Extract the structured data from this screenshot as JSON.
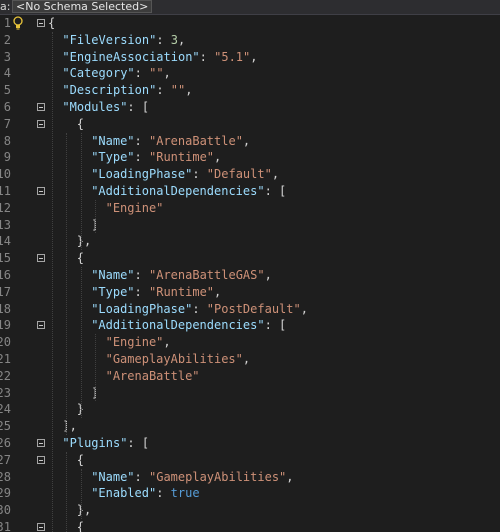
{
  "schema_bar": {
    "prefix": "a:",
    "selected": "<No Schema Selected>"
  },
  "lines": [
    {
      "num": "1",
      "fold": true,
      "tokens": [
        [
          "p",
          "{"
        ]
      ]
    },
    {
      "num": "2",
      "tokens": [
        [
          "k",
          "\"FileVersion\""
        ],
        [
          "p",
          ": "
        ],
        [
          "n",
          "3"
        ],
        [
          "p",
          ","
        ]
      ]
    },
    {
      "num": "3",
      "tokens": [
        [
          "k",
          "\"EngineAssociation\""
        ],
        [
          "p",
          ": "
        ],
        [
          "s",
          "\"5.1\""
        ],
        [
          "p",
          ","
        ]
      ]
    },
    {
      "num": "4",
      "tokens": [
        [
          "k",
          "\"Category\""
        ],
        [
          "p",
          ": "
        ],
        [
          "s",
          "\"\""
        ],
        [
          "p",
          ","
        ]
      ]
    },
    {
      "num": "5",
      "tokens": [
        [
          "k",
          "\"Description\""
        ],
        [
          "p",
          ": "
        ],
        [
          "s",
          "\"\""
        ],
        [
          "p",
          ","
        ]
      ]
    },
    {
      "num": "6",
      "fold": true,
      "tokens": [
        [
          "k",
          "\"Modules\""
        ],
        [
          "p",
          ": ["
        ]
      ]
    },
    {
      "num": "7",
      "fold": true,
      "tokens": [
        [
          "p",
          "{"
        ]
      ]
    },
    {
      "num": "8",
      "tokens": [
        [
          "k",
          "\"Name\""
        ],
        [
          "p",
          ": "
        ],
        [
          "s",
          "\"ArenaBattle\""
        ],
        [
          "p",
          ","
        ]
      ]
    },
    {
      "num": "9",
      "tokens": [
        [
          "k",
          "\"Type\""
        ],
        [
          "p",
          ": "
        ],
        [
          "s",
          "\"Runtime\""
        ],
        [
          "p",
          ","
        ]
      ]
    },
    {
      "num": "10",
      "tokens": [
        [
          "k",
          "\"LoadingPhase\""
        ],
        [
          "p",
          ": "
        ],
        [
          "s",
          "\"Default\""
        ],
        [
          "p",
          ","
        ]
      ]
    },
    {
      "num": "11",
      "fold": true,
      "tokens": [
        [
          "k",
          "\"AdditionalDependencies\""
        ],
        [
          "p",
          ": ["
        ]
      ]
    },
    {
      "num": "12",
      "tokens": [
        [
          "s",
          "\"Engine\""
        ]
      ]
    },
    {
      "num": "13",
      "tokens": [
        [
          "p",
          "]"
        ]
      ]
    },
    {
      "num": "14",
      "tokens": [
        [
          "p",
          "},"
        ]
      ]
    },
    {
      "num": "15",
      "fold": true,
      "tokens": [
        [
          "p",
          "{"
        ]
      ]
    },
    {
      "num": "16",
      "tokens": [
        [
          "k",
          "\"Name\""
        ],
        [
          "p",
          ": "
        ],
        [
          "s",
          "\"ArenaBattleGAS\""
        ],
        [
          "p",
          ","
        ]
      ]
    },
    {
      "num": "17",
      "tokens": [
        [
          "k",
          "\"Type\""
        ],
        [
          "p",
          ": "
        ],
        [
          "s",
          "\"Runtime\""
        ],
        [
          "p",
          ","
        ]
      ]
    },
    {
      "num": "18",
      "tokens": [
        [
          "k",
          "\"LoadingPhase\""
        ],
        [
          "p",
          ": "
        ],
        [
          "s",
          "\"PostDefault\""
        ],
        [
          "p",
          ","
        ]
      ]
    },
    {
      "num": "19",
      "fold": true,
      "tokens": [
        [
          "k",
          "\"AdditionalDependencies\""
        ],
        [
          "p",
          ": ["
        ]
      ]
    },
    {
      "num": "20",
      "tokens": [
        [
          "s",
          "\"Engine\""
        ],
        [
          "p",
          ","
        ]
      ]
    },
    {
      "num": "21",
      "tokens": [
        [
          "s",
          "\"GameplayAbilities\""
        ],
        [
          "p",
          ","
        ]
      ]
    },
    {
      "num": "22",
      "tokens": [
        [
          "s",
          "\"ArenaBattle\""
        ]
      ]
    },
    {
      "num": "23",
      "tokens": [
        [
          "p",
          "]"
        ]
      ]
    },
    {
      "num": "24",
      "tokens": [
        [
          "p",
          "}"
        ]
      ]
    },
    {
      "num": "25",
      "tokens": [
        [
          "p",
          "],"
        ]
      ]
    },
    {
      "num": "26",
      "fold": true,
      "tokens": [
        [
          "k",
          "\"Plugins\""
        ],
        [
          "p",
          ": ["
        ]
      ]
    },
    {
      "num": "27",
      "fold": true,
      "tokens": [
        [
          "p",
          "{"
        ]
      ]
    },
    {
      "num": "28",
      "tokens": [
        [
          "k",
          "\"Name\""
        ],
        [
          "p",
          ": "
        ],
        [
          "s",
          "\"GameplayAbilities\""
        ],
        [
          "p",
          ","
        ]
      ]
    },
    {
      "num": "29",
      "tokens": [
        [
          "k",
          "\"Enabled\""
        ],
        [
          "p",
          ": "
        ],
        [
          "b",
          "true"
        ]
      ]
    },
    {
      "num": "30",
      "tokens": [
        [
          "p",
          "},"
        ]
      ]
    },
    {
      "num": "31",
      "fold": true,
      "tokens": [
        [
          "p",
          "{"
        ]
      ]
    }
  ],
  "icons": {
    "lightbulb": "lightbulb-icon",
    "fold": "collapse-toggle-icon"
  }
}
